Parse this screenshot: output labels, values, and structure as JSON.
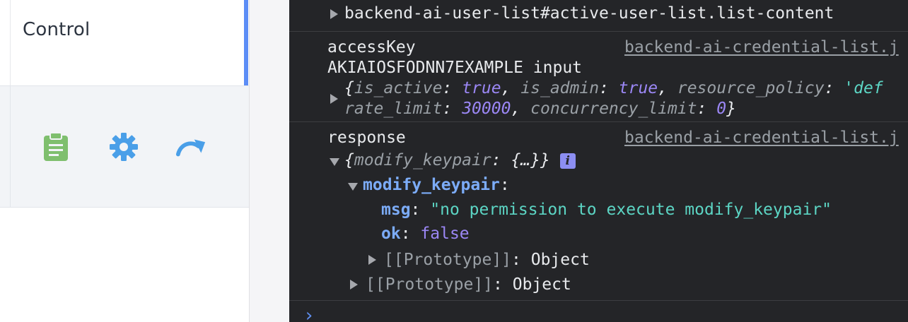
{
  "app": {
    "control_label": "Control",
    "icons": [
      "clipboard-icon",
      "gear-icon",
      "redo-arrow-icon"
    ],
    "colors": {
      "accent": "#5c8df6",
      "clipboard": "#7fbf6e",
      "gear": "#4a9fe8",
      "arrow": "#4a9fe8"
    }
  },
  "console": {
    "entry1": {
      "text": "backend-ai-user-list#active-user-list.list-content"
    },
    "entry2": {
      "label": "accessKey",
      "source": "backend-ai-credential-list.j",
      "line2": "AKIAIOSFODNN7EXAMPLE input",
      "obj": {
        "k1": "is_active",
        "v1": "true",
        "k2": "is_admin",
        "v2": "true",
        "k3": "resource_policy",
        "v3": "'def",
        "k4": "rate_limit",
        "v4": "30000",
        "k5": "concurrency_limit",
        "v5": "0"
      }
    },
    "entry3": {
      "label": "response",
      "source": "backend-ai-credential-list.j",
      "summary_key": "modify_keypair",
      "summary_val": "{…}",
      "info_glyph": "i",
      "expanded_key": "modify_keypair",
      "msg_key": "msg",
      "msg_val": "\"no permission to execute modify_keypair\"",
      "ok_key": "ok",
      "ok_val": "false",
      "proto_inner": "[[Prototype]]",
      "proto_inner_val": "Object",
      "proto_outer": "[[Prototype]]",
      "proto_outer_val": "Object"
    },
    "prompt": "›"
  }
}
